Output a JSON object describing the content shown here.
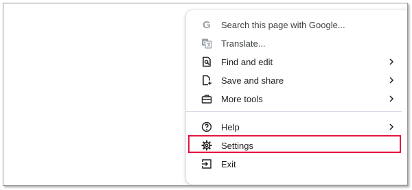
{
  "menu": {
    "items": [
      {
        "label": "Search this page with Google...",
        "icon": "google-g-icon",
        "submenu": false
      },
      {
        "label": "Translate...",
        "icon": "translate-icon",
        "submenu": false
      },
      {
        "label": "Find and edit",
        "icon": "find-edit-icon",
        "submenu": true
      },
      {
        "label": "Save and share",
        "icon": "save-share-icon",
        "submenu": true
      },
      {
        "label": "More tools",
        "icon": "toolbox-icon",
        "submenu": true
      },
      {
        "label": "Help",
        "icon": "help-icon",
        "submenu": true
      },
      {
        "label": "Settings",
        "icon": "gear-icon",
        "submenu": false,
        "highlighted": true
      },
      {
        "label": "Exit",
        "icon": "exit-icon",
        "submenu": false
      }
    ]
  },
  "colors": {
    "highlight_border": "#e4123e",
    "divider": "#d6dbe3",
    "text": "#1f1f1f"
  }
}
